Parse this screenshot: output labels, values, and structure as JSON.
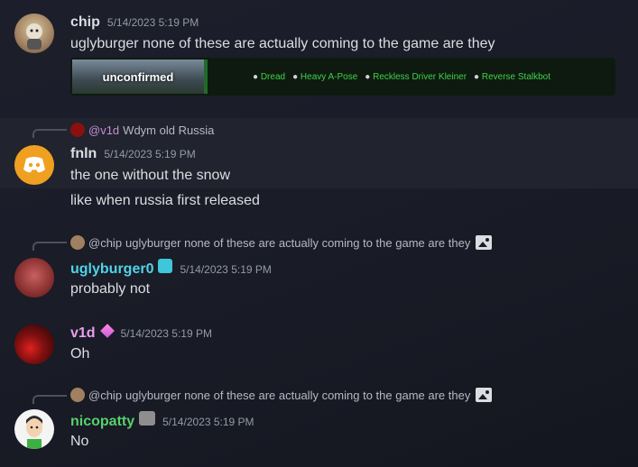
{
  "messages": [
    {
      "username": "chip",
      "timestamp": "5/14/2023 5:19 PM",
      "content": "uglyburger none of these are actually coming to the game are they",
      "embed": {
        "thumb_label": "unconfirmed",
        "tags": [
          "Dread",
          "Heavy A-Pose",
          "Reckless Driver Kleiner",
          "Reverse Stalkbot"
        ]
      }
    },
    {
      "reply_to": {
        "name": "@v1d",
        "text": "Wdym old Russia"
      },
      "username": "fnln",
      "timestamp": "5/14/2023 5:19 PM",
      "content": "the one without the snow",
      "followup": "like when russia first released"
    },
    {
      "reply_to": {
        "name": "@chip",
        "text": "uglyburger none of these are actually coming to the game are they"
      },
      "username": "uglyburger0",
      "timestamp": "5/14/2023 5:19 PM",
      "content": "probably not"
    },
    {
      "username": "v1d",
      "timestamp": "5/14/2023 5:19 PM",
      "content": "Oh"
    },
    {
      "reply_to": {
        "name": "@chip",
        "text": "uglyburger none of these are actually coming to the game are they"
      },
      "username": "nicopatty",
      "timestamp": "5/14/2023 5:19 PM",
      "content": "No"
    }
  ],
  "colors": {
    "chip": "#dbdee1",
    "fnln": "#dbdee1",
    "uglyburger0": "#4fd3e6",
    "v1d": "#e8a0e8",
    "nicopatty": "#57d16b",
    "reply_v1d": "#c38fd6"
  }
}
